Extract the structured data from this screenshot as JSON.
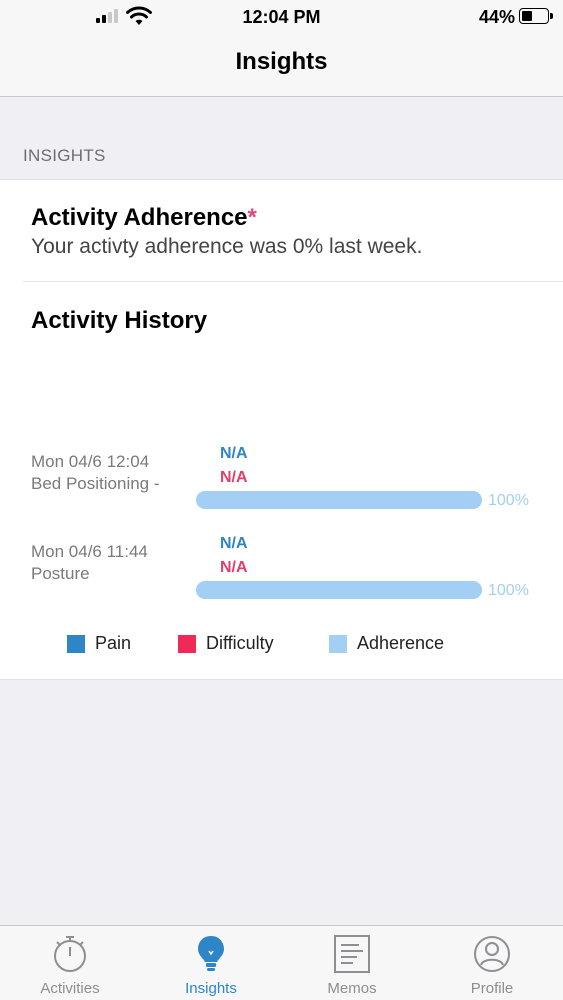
{
  "status_bar": {
    "time": "12:04 PM",
    "battery": "44%"
  },
  "nav": {
    "title": "Insights"
  },
  "section_header": "INSIGHTS",
  "adherence": {
    "title": "Activity Adherence",
    "asterisk": "*",
    "description": "Your activty adherence was 0% last week."
  },
  "history": {
    "title": "Activity History",
    "rows": [
      {
        "date": "Mon 04/6 12:04",
        "name": "Bed Positioning -",
        "pain": "N/A",
        "difficulty": "N/A",
        "adherence_pct": "100%",
        "adherence": 1.0
      },
      {
        "date": "Mon 04/6 11:44",
        "name": "Posture",
        "pain": "N/A",
        "difficulty": "N/A",
        "adherence_pct": "100%",
        "adherence": 1.0
      }
    ]
  },
  "legend": [
    {
      "label": "Pain",
      "color": "#2e86c6"
    },
    {
      "label": "Difficulty",
      "color": "#f02a56"
    },
    {
      "label": "Adherence",
      "color": "#a3cff4"
    }
  ],
  "colors": {
    "accent": "#2e86c6",
    "pain": "#2e86c6",
    "difficulty": "#e0406b",
    "adherence": "#a3cff4"
  },
  "tabs": [
    {
      "label": "Activities",
      "icon": "stopwatch-icon",
      "active": false
    },
    {
      "label": "Insights",
      "icon": "lightbulb-icon",
      "active": true
    },
    {
      "label": "Memos",
      "icon": "memo-icon",
      "active": false
    },
    {
      "label": "Profile",
      "icon": "profile-icon",
      "active": false
    }
  ]
}
